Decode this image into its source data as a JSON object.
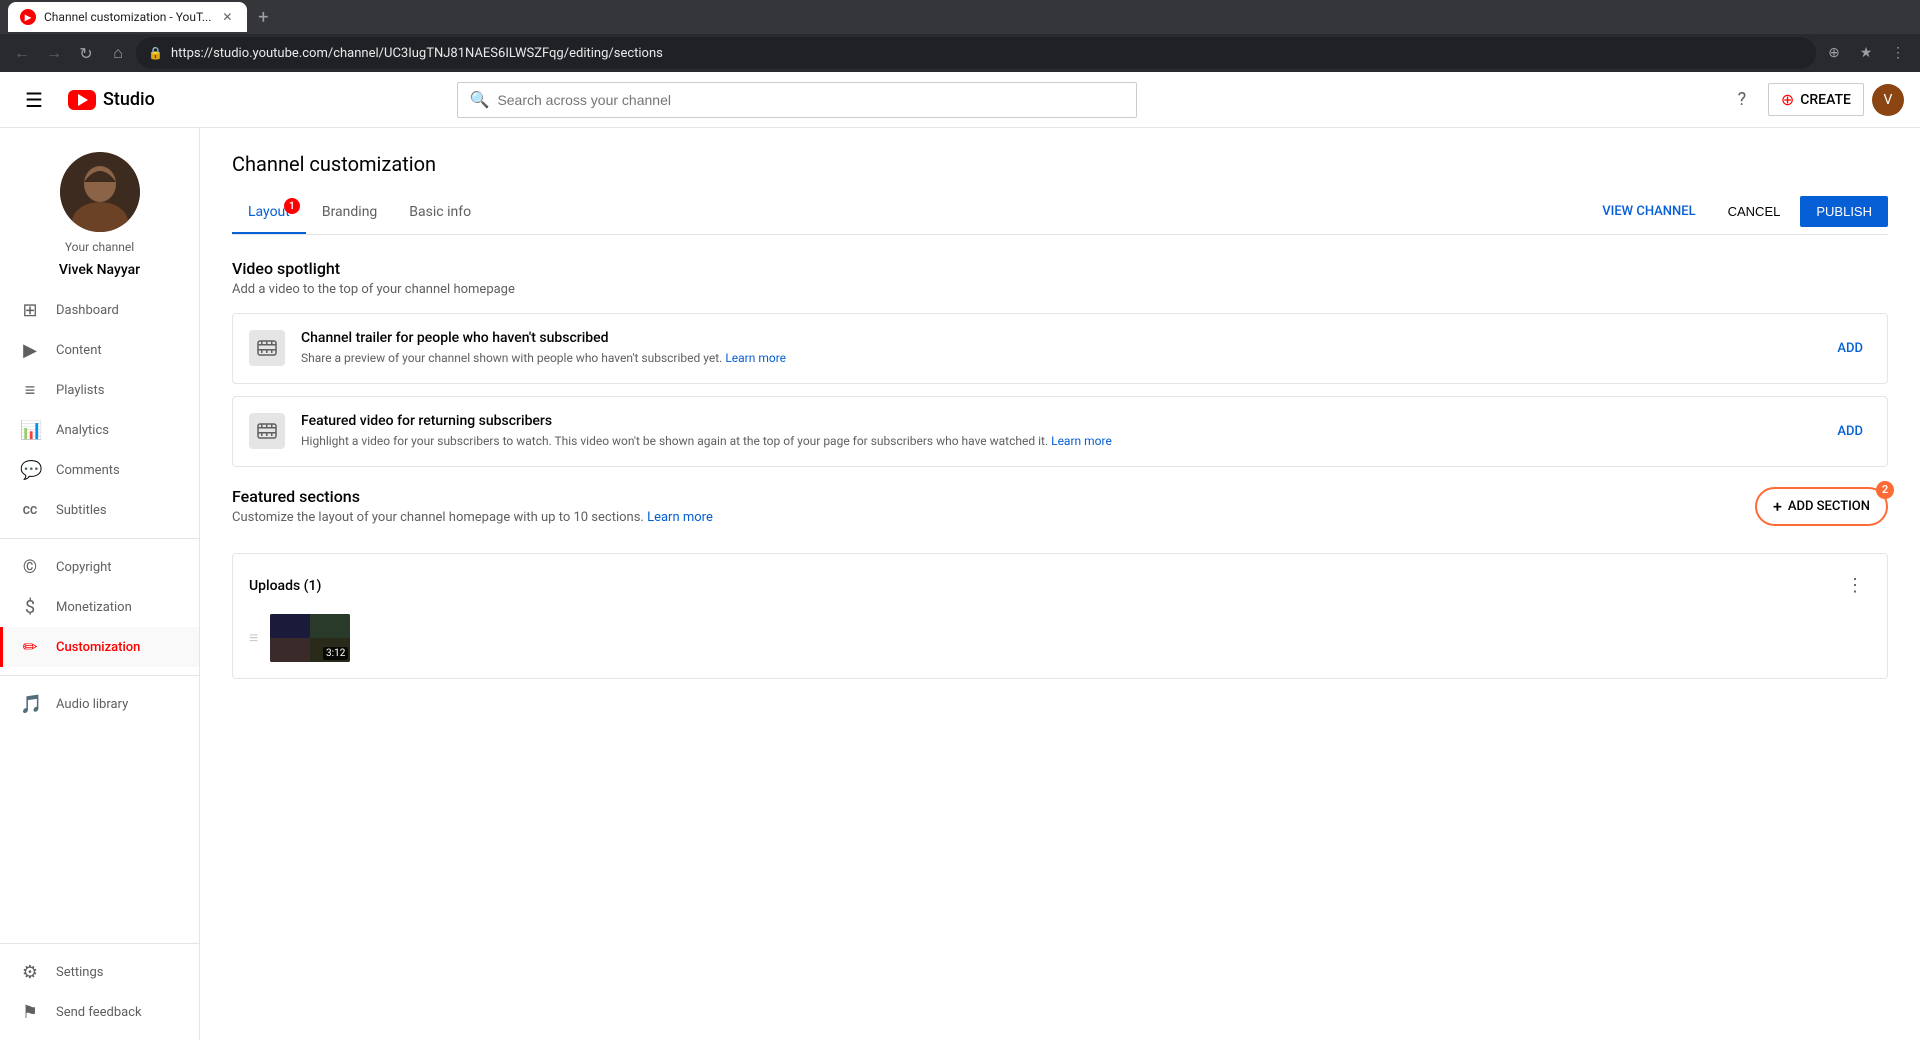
{
  "browser": {
    "tab_title": "Channel customization - YouT...",
    "tab_favicon": "YT",
    "url": "https://studio.youtube.com/channel/UC3IugTNJ81NAES6ILWSZFqg/editing/sections",
    "new_tab_icon": "+"
  },
  "topbar": {
    "hamburger_icon": "☰",
    "logo_text": "Studio",
    "search_placeholder": "Search across your channel",
    "help_icon": "?",
    "create_label": "CREATE",
    "create_icon": "⊕"
  },
  "sidebar": {
    "your_channel_label": "Your channel",
    "channel_name": "Vivek Nayyar",
    "items": [
      {
        "id": "dashboard",
        "icon": "⊞",
        "label": "Dashboard",
        "active": false
      },
      {
        "id": "content",
        "icon": "▶",
        "label": "Content",
        "active": false
      },
      {
        "id": "playlists",
        "icon": "≡",
        "label": "Playlists",
        "active": false
      },
      {
        "id": "analytics",
        "icon": "📊",
        "label": "Analytics",
        "active": false
      },
      {
        "id": "comments",
        "icon": "💬",
        "label": "Comments",
        "active": false
      },
      {
        "id": "subtitles",
        "icon": "CC",
        "label": "Subtitles",
        "active": false
      },
      {
        "id": "copyright",
        "icon": "©",
        "label": "Copyright",
        "active": false
      },
      {
        "id": "monetization",
        "icon": "$",
        "label": "Monetization",
        "active": false
      },
      {
        "id": "customization",
        "icon": "✏",
        "label": "Customization",
        "active": true
      }
    ],
    "bottom_items": [
      {
        "id": "audio-library",
        "icon": "🎵",
        "label": "Audio library",
        "active": false
      }
    ],
    "settings_label": "Settings",
    "feedback_label": "Send feedback"
  },
  "page": {
    "title": "Channel customization",
    "tabs": [
      {
        "id": "layout",
        "label": "Layout",
        "active": true,
        "badge": "1"
      },
      {
        "id": "branding",
        "label": "Branding",
        "active": false,
        "badge": null
      },
      {
        "id": "basic-info",
        "label": "Basic info",
        "active": false,
        "badge": null
      }
    ],
    "actions": {
      "view_channel": "VIEW CHANNEL",
      "cancel": "CANCEL",
      "publish": "PUBLISH"
    },
    "video_spotlight": {
      "section_title": "Video spotlight",
      "section_subtitle": "Add a video to the top of your channel homepage",
      "cards": [
        {
          "id": "channel-trailer",
          "title": "Channel trailer for people who haven't subscribed",
          "description": "Share a preview of your channel shown with people who haven't subscribed yet.",
          "link_text": "Learn more",
          "action": "ADD"
        },
        {
          "id": "featured-video",
          "title": "Featured video for returning subscribers",
          "description": "Highlight a video for your subscribers to watch. This video won't be shown again at the top of your page for subscribers who have watched it.",
          "link_text": "Learn more",
          "action": "ADD"
        }
      ]
    },
    "featured_sections": {
      "title": "Featured sections",
      "subtitle": "Customize the layout of your channel homepage with up to 10 sections.",
      "link_text": "Learn more",
      "add_button": "ADD SECTION",
      "add_button_badge": "2",
      "uploads": {
        "title": "Uploads (1)",
        "duration": "3:12"
      }
    }
  }
}
